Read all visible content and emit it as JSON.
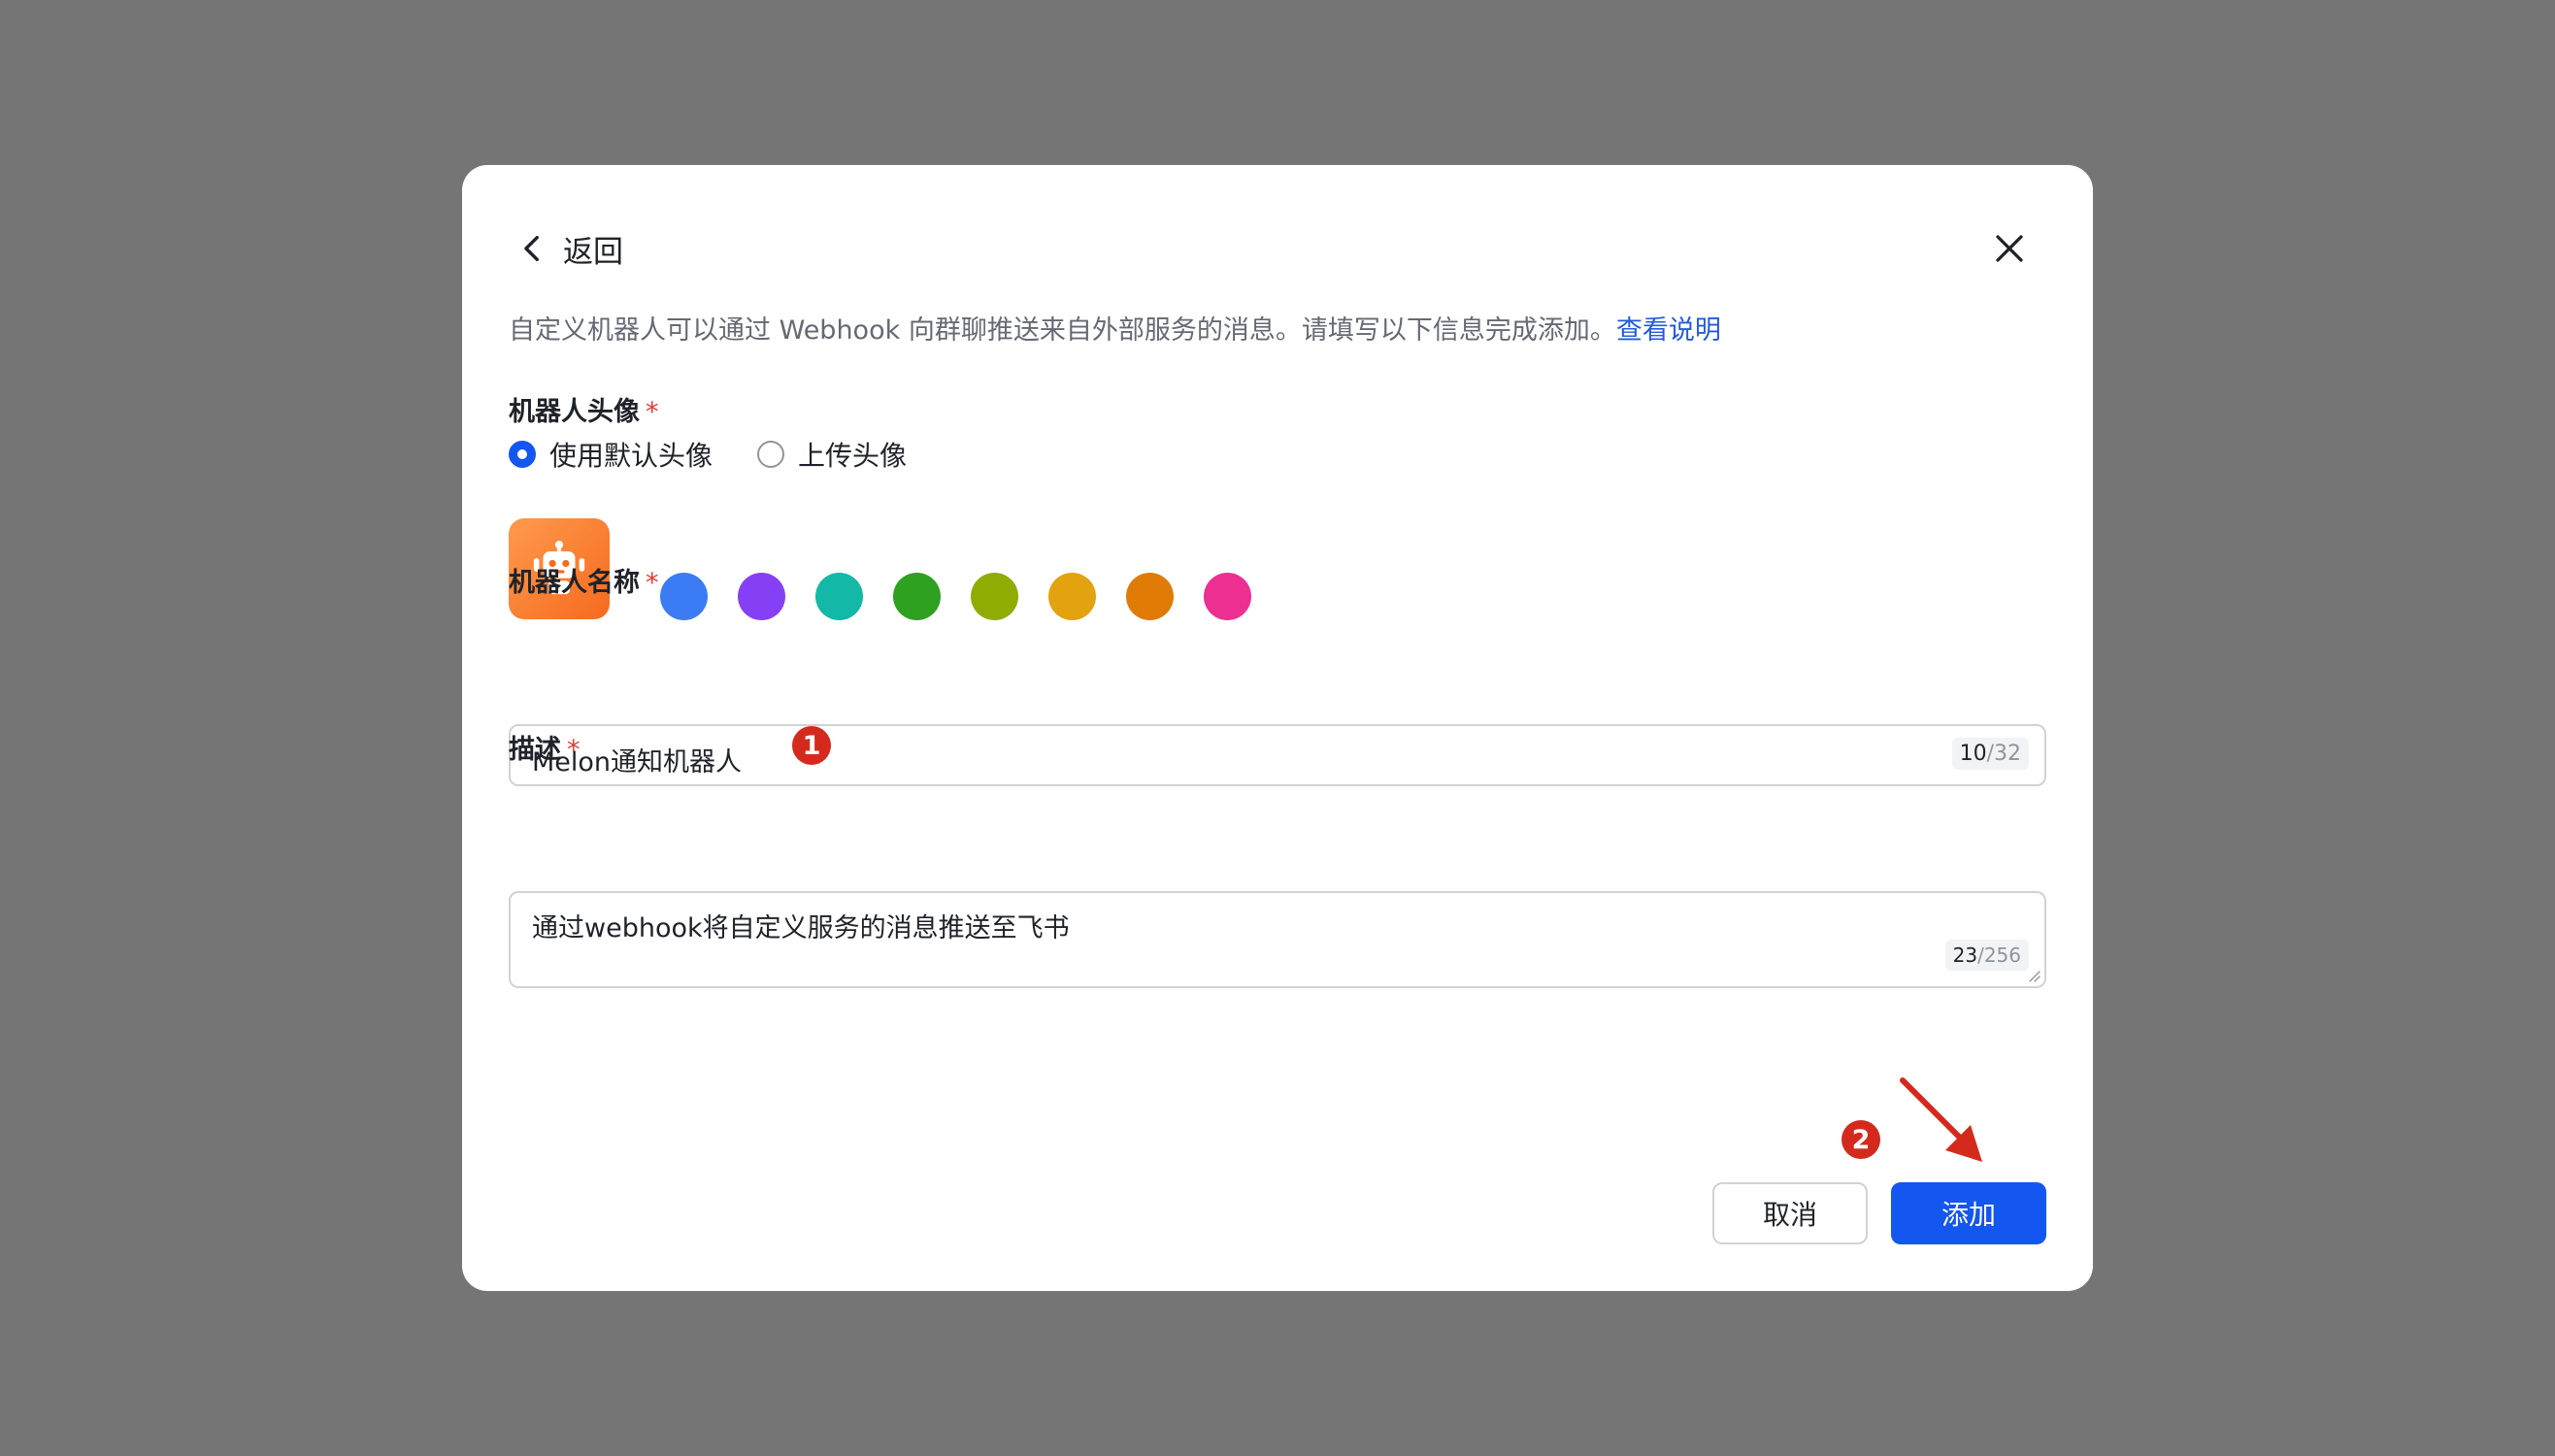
{
  "dialog": {
    "back_label": "返回",
    "description": "自定义机器人可以通过 Webhook 向群聊推送来自外部服务的消息。请填写以下信息完成添加。",
    "help_link": "查看说明"
  },
  "avatar_section": {
    "label": "机器人头像",
    "required_mark": "*",
    "options": [
      {
        "label": "使用默认头像",
        "checked": true
      },
      {
        "label": "上传头像",
        "checked": false
      }
    ],
    "avatar_icon": "robot-icon",
    "avatar_color": "#f77b2c",
    "swatch_colors": [
      "#3b7cf5",
      "#8540f5",
      "#14b8a6",
      "#2ea121",
      "#8fac02",
      "#e3a20f",
      "#e07b07",
      "#ed2f91"
    ]
  },
  "name_section": {
    "label": "机器人名称",
    "required_mark": "*",
    "value": "Melon通知机器人",
    "count_current": "10",
    "count_max": "/32"
  },
  "description_section": {
    "label": "描述",
    "required_mark": "*",
    "value": "通过webhook将自定义服务的消息推送至飞书",
    "count_current": "23",
    "count_max": "/256"
  },
  "annotations": {
    "marker_1": "1",
    "marker_2": "2",
    "marker_color": "#d42a1e"
  },
  "footer": {
    "cancel_label": "取消",
    "add_label": "添加",
    "primary_color": "#1456f0"
  }
}
